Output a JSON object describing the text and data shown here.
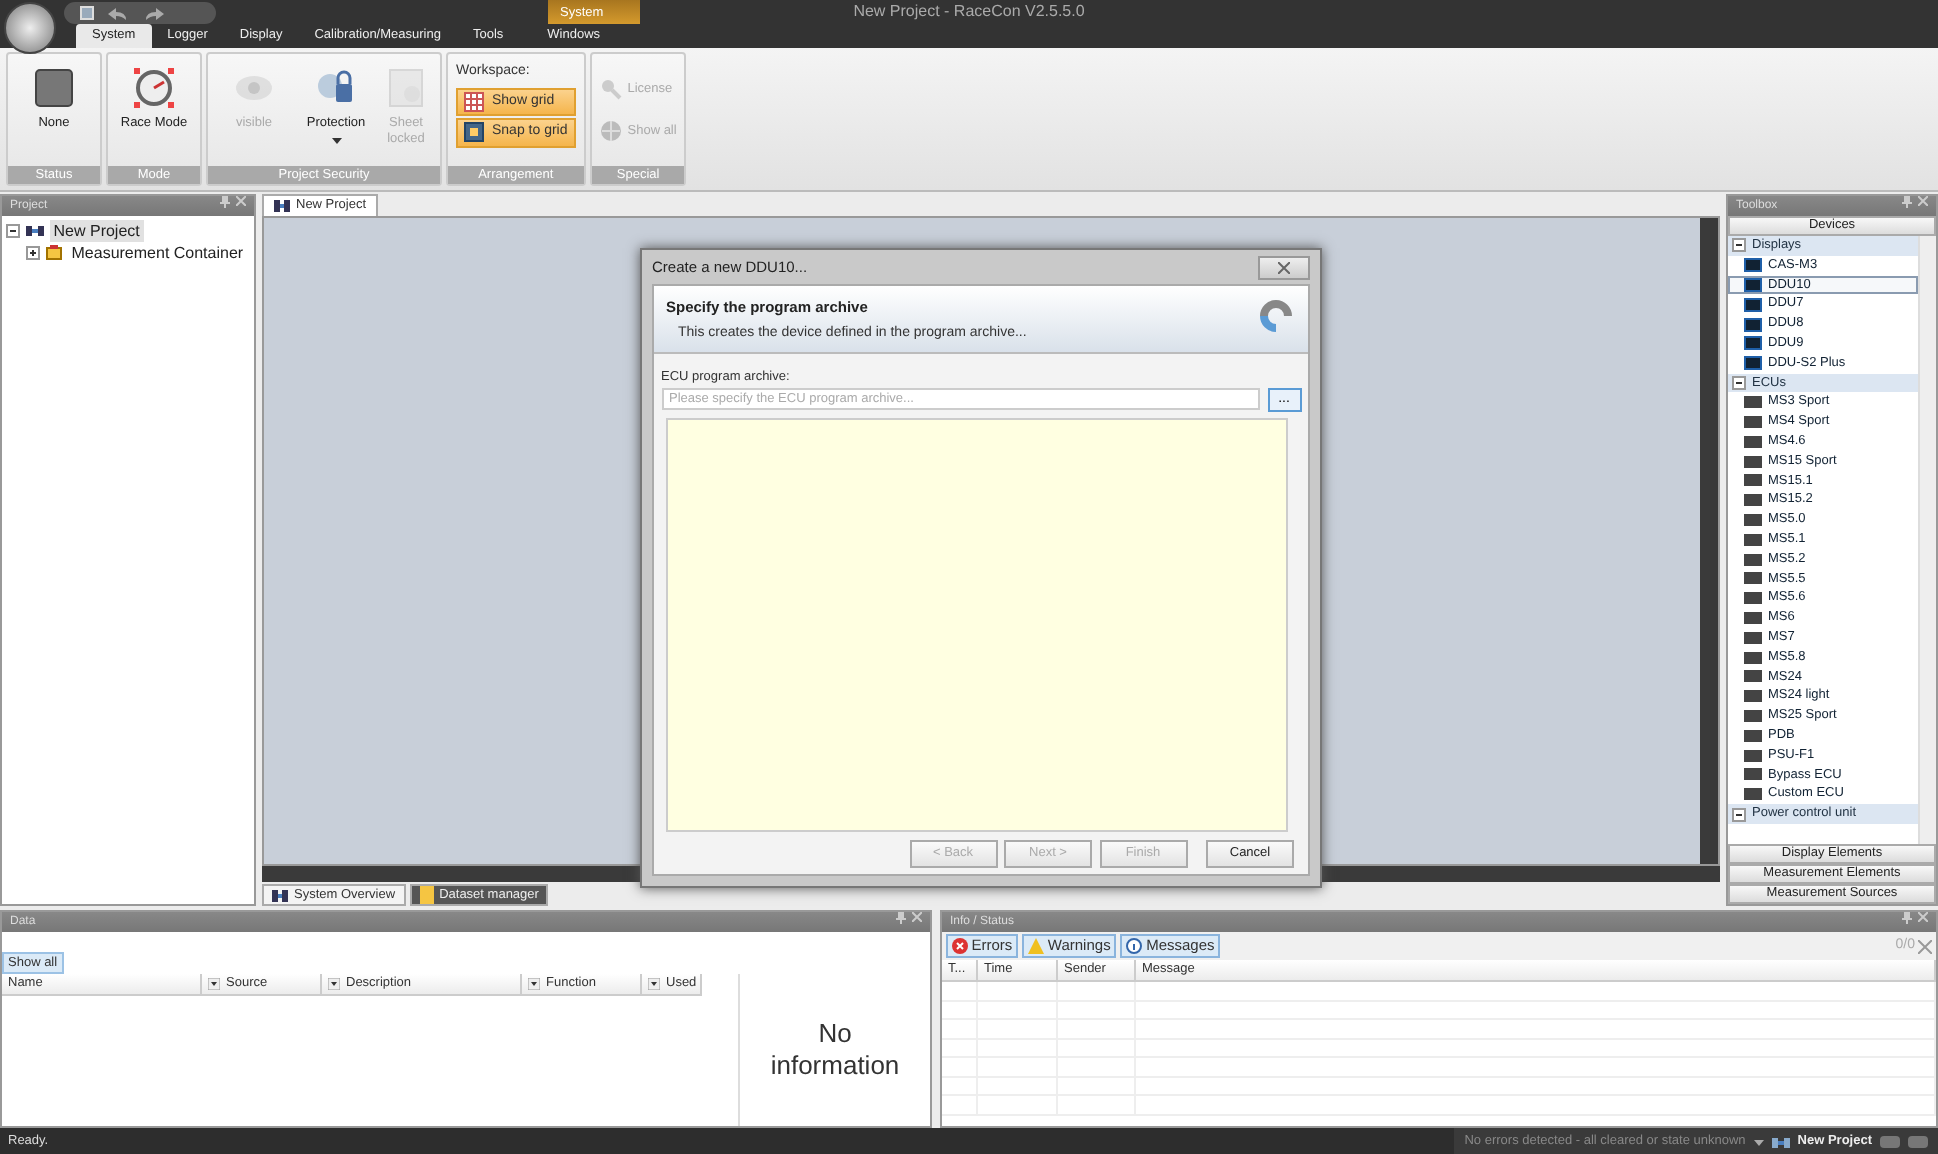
{
  "window": {
    "title": "New Project - RaceCon V2.5.5.0",
    "context_tab": "System"
  },
  "ribbon_tabs": [
    {
      "label": "System",
      "selected": true
    },
    {
      "label": "Logger",
      "selected": false
    },
    {
      "label": "Display",
      "selected": false
    },
    {
      "label": "Calibration/Measuring",
      "selected": false
    },
    {
      "label": "Tools",
      "selected": false
    },
    {
      "label": "Windows",
      "selected": false
    }
  ],
  "ribbon_groups": [
    {
      "caption": "Status",
      "items": [
        {
          "kind": "large",
          "label": "None",
          "disabled": false
        }
      ]
    },
    {
      "caption": "Mode",
      "items": [
        {
          "kind": "large",
          "label": "Race Mode",
          "disabled": false
        }
      ]
    },
    {
      "caption": "Project Security",
      "items": [
        {
          "kind": "large",
          "label": "visible",
          "disabled": true
        },
        {
          "kind": "large",
          "label": "Protection",
          "disabled": false,
          "dropdown": true
        },
        {
          "kind": "large",
          "label": "Sheet locked",
          "disabled": true
        }
      ]
    },
    {
      "caption": "Arrangement",
      "heading": "Workspace:",
      "items": [
        {
          "kind": "toggle",
          "label": "Show grid",
          "checked": true
        },
        {
          "kind": "toggle",
          "label": "Snap to grid",
          "checked": true
        }
      ]
    },
    {
      "caption": "Special",
      "items": [
        {
          "kind": "small",
          "label": "License",
          "disabled": true
        },
        {
          "kind": "small",
          "label": "Show all",
          "disabled": true
        }
      ]
    }
  ],
  "project_panel": {
    "title": "Project",
    "tree": [
      {
        "label": "New Project",
        "selected": true,
        "expanded": true,
        "children": [
          {
            "label": "Measurement Container",
            "selected": false,
            "expanded": false
          }
        ]
      }
    ]
  },
  "document_tabs": [
    {
      "label": "New Project",
      "selected": true
    }
  ],
  "bottom_tabs": [
    {
      "label": "System Overview",
      "selected": false
    },
    {
      "label": "Dataset manager",
      "selected": true
    }
  ],
  "dialog": {
    "title": "Create a new DDU10...",
    "heading": "Specify the program archive",
    "subheading": "This creates the device defined in the program archive...",
    "field_label": "ECU program archive:",
    "placeholder": "Please specify the ECU program archive...",
    "browse": "...",
    "buttons": [
      {
        "label": "< Back",
        "disabled": true
      },
      {
        "label": "Next >",
        "disabled": true
      },
      {
        "label": "Finish",
        "disabled": true
      },
      {
        "label": "Cancel",
        "disabled": false
      }
    ]
  },
  "toolbox": {
    "title": "Toolbox",
    "top_sections": [
      "Devices"
    ],
    "groups": [
      {
        "label": "Displays",
        "kind": "display",
        "expanded": true,
        "items": [
          {
            "label": "CAS-M3",
            "selected": false
          },
          {
            "label": "DDU10",
            "selected": true
          },
          {
            "label": "DDU7",
            "selected": false
          },
          {
            "label": "DDU8",
            "selected": false
          },
          {
            "label": "DDU9",
            "selected": false
          },
          {
            "label": "DDU-S2 Plus",
            "selected": false
          }
        ]
      },
      {
        "label": "ECUs",
        "kind": "ecu",
        "expanded": true,
        "items": [
          {
            "label": "MS3 Sport",
            "selected": false
          },
          {
            "label": "MS4 Sport",
            "selected": false
          },
          {
            "label": "MS4.6",
            "selected": false
          },
          {
            "label": "MS15 Sport",
            "selected": false
          },
          {
            "label": "MS15.1",
            "selected": false
          },
          {
            "label": "MS15.2",
            "selected": false
          },
          {
            "label": "MS5.0",
            "selected": false
          },
          {
            "label": "MS5.1",
            "selected": false
          },
          {
            "label": "MS5.2",
            "selected": false
          },
          {
            "label": "MS5.5",
            "selected": false
          },
          {
            "label": "MS5.6",
            "selected": false
          },
          {
            "label": "MS6",
            "selected": false
          },
          {
            "label": "MS7",
            "selected": false
          },
          {
            "label": "MS5.8",
            "selected": false
          },
          {
            "label": "MS24",
            "selected": false
          },
          {
            "label": "MS24 light",
            "selected": false
          },
          {
            "label": "MS25 Sport",
            "selected": false
          },
          {
            "label": "PDB",
            "selected": false
          },
          {
            "label": "PSU-F1",
            "selected": false
          },
          {
            "label": "Bypass ECU",
            "selected": false
          },
          {
            "label": "Custom ECU",
            "selected": false
          }
        ]
      },
      {
        "label": "Power control unit",
        "expanded": true
      }
    ],
    "bottom_sections": [
      "Display Elements",
      "Measurement Elements",
      "Measurement Sources"
    ]
  },
  "data_panel": {
    "title": "Data",
    "button": "Show all",
    "columns": [
      "Name",
      "Source",
      "Description",
      "Function",
      "Used"
    ],
    "side_text": "No information"
  },
  "info_panel": {
    "title": "Info / Status",
    "filters": [
      {
        "label": "Errors",
        "kind": "error",
        "selected": true
      },
      {
        "label": "Warnings",
        "kind": "warning",
        "selected": true
      },
      {
        "label": "Messages",
        "kind": "info",
        "selected": true
      }
    ],
    "counter": "0/0",
    "columns": [
      "T...",
      "Time",
      "Sender",
      "Message"
    ]
  },
  "status_bar": {
    "text": "Ready.",
    "state": "No errors detected - all cleared or state unknown",
    "project": "New Project"
  }
}
